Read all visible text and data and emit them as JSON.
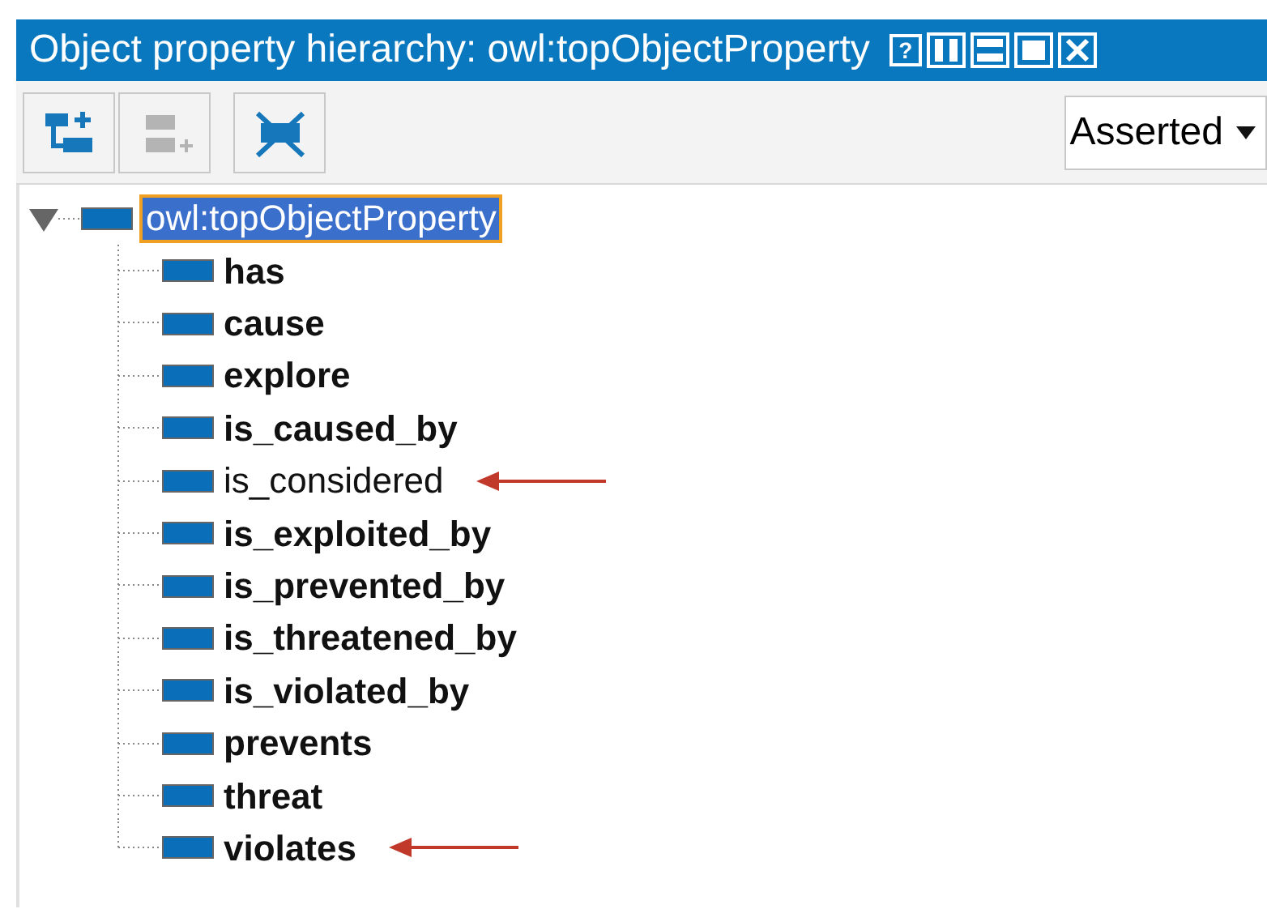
{
  "window": {
    "title": "Object property hierarchy: owl:topObjectProperty",
    "controls": [
      "?"
    ]
  },
  "toolbar": {
    "buttons": [
      {
        "kind": "add-sub",
        "disabled": false
      },
      {
        "kind": "add-sibling",
        "disabled": true
      },
      {
        "kind": "delete",
        "disabled": false
      }
    ],
    "dropdown": {
      "value": "Asserted"
    }
  },
  "tree": {
    "root": {
      "label": "owl:topObjectProperty",
      "selected": true,
      "expanded": true,
      "children": [
        {
          "label": "has",
          "bold": true,
          "annotated": false
        },
        {
          "label": "cause",
          "bold": true,
          "annotated": false
        },
        {
          "label": "explore",
          "bold": true,
          "annotated": false
        },
        {
          "label": "is_caused_by",
          "bold": true,
          "annotated": false
        },
        {
          "label": "is_considered",
          "bold": false,
          "annotated": true
        },
        {
          "label": "is_exploited_by",
          "bold": true,
          "annotated": false
        },
        {
          "label": "is_prevented_by",
          "bold": true,
          "annotated": false
        },
        {
          "label": "is_threatened_by",
          "bold": true,
          "annotated": false
        },
        {
          "label": "is_violated_by",
          "bold": true,
          "annotated": false
        },
        {
          "label": "prevents",
          "bold": true,
          "annotated": false
        },
        {
          "label": "threat",
          "bold": true,
          "annotated": false
        },
        {
          "label": "violates",
          "bold": true,
          "annotated": true
        }
      ]
    }
  }
}
